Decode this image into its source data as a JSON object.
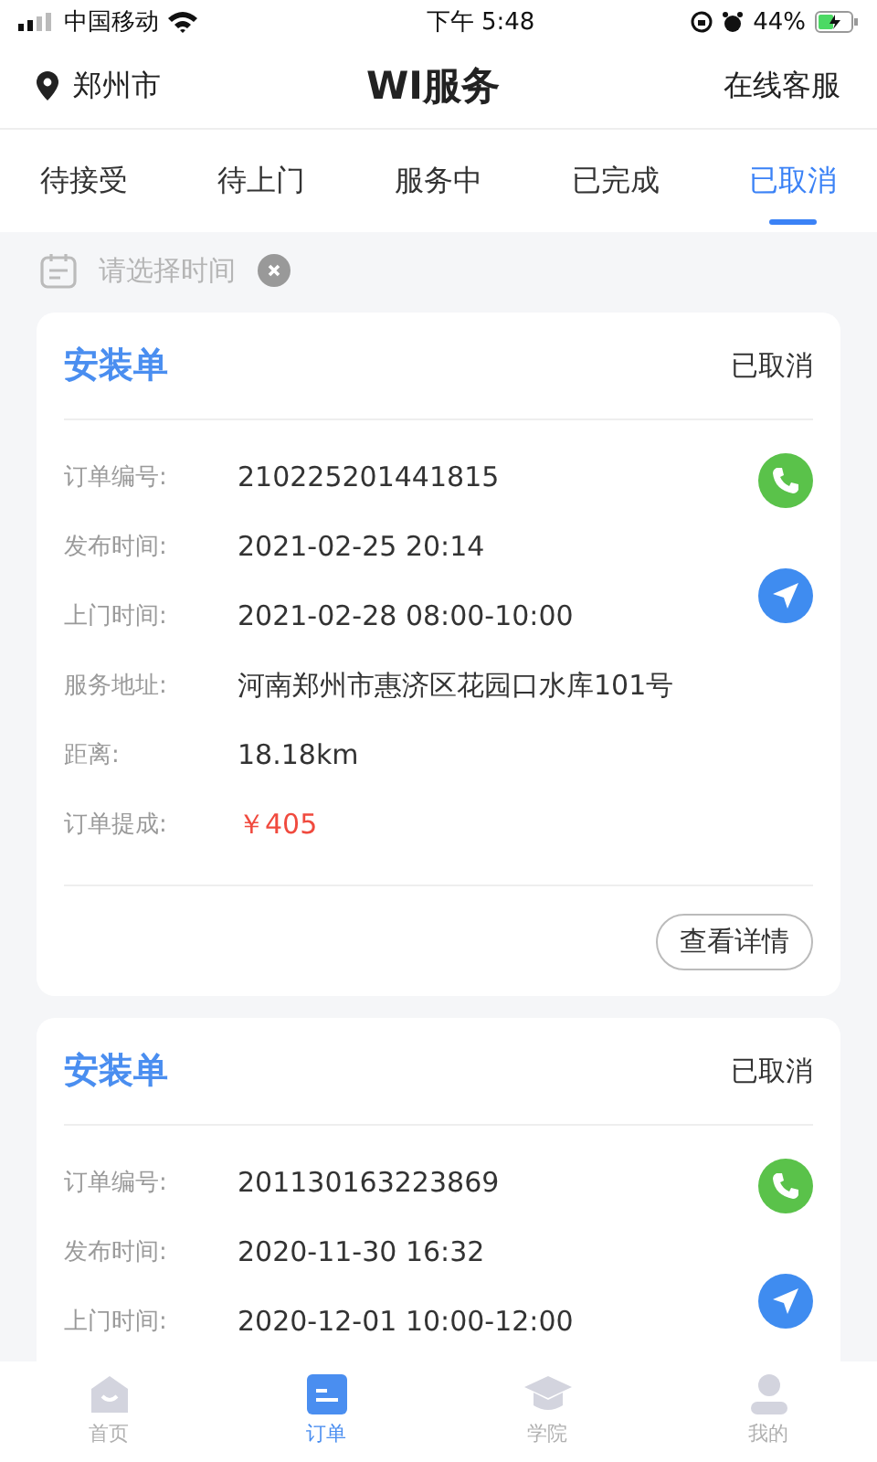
{
  "status_bar": {
    "carrier": "中国移动",
    "time": "下午 5:48",
    "battery": "44%"
  },
  "header": {
    "city": "郑州市",
    "title": "WI服务",
    "service": "在线客服"
  },
  "tabs": [
    {
      "label": "待接受",
      "selected": false
    },
    {
      "label": "待上门",
      "selected": false
    },
    {
      "label": "服务中",
      "selected": false
    },
    {
      "label": "已完成",
      "selected": false
    },
    {
      "label": "已取消",
      "selected": true
    }
  ],
  "date_filter": {
    "placeholder": "请选择时间"
  },
  "orders": [
    {
      "type": "安装单",
      "status": "已取消",
      "fields": [
        {
          "label": "订单编号:",
          "value": "210225201441815"
        },
        {
          "label": "发布时间:",
          "value": "2021-02-25 20:14"
        },
        {
          "label": "上门时间:",
          "value": "2021-02-28 08:00-10:00"
        },
        {
          "label": "服务地址:",
          "value": "河南郑州市惠济区花园口水库101号"
        },
        {
          "label": "距离:",
          "value": "18.18km"
        },
        {
          "label": "订单提成:",
          "value": "￥405",
          "kind": "price"
        }
      ],
      "button": "查看详情"
    },
    {
      "type": "安装单",
      "status": "已取消",
      "fields": [
        {
          "label": "订单编号:",
          "value": "201130163223869"
        },
        {
          "label": "发布时间:",
          "value": "2020-11-30 16:32"
        },
        {
          "label": "上门时间:",
          "value": "2020-12-01 10:00-12:00"
        }
      ]
    }
  ],
  "bottom_nav": [
    {
      "label": "首页",
      "selected": false
    },
    {
      "label": "订单",
      "selected": true
    },
    {
      "label": "学院",
      "selected": false
    },
    {
      "label": "我的",
      "selected": false
    }
  ]
}
